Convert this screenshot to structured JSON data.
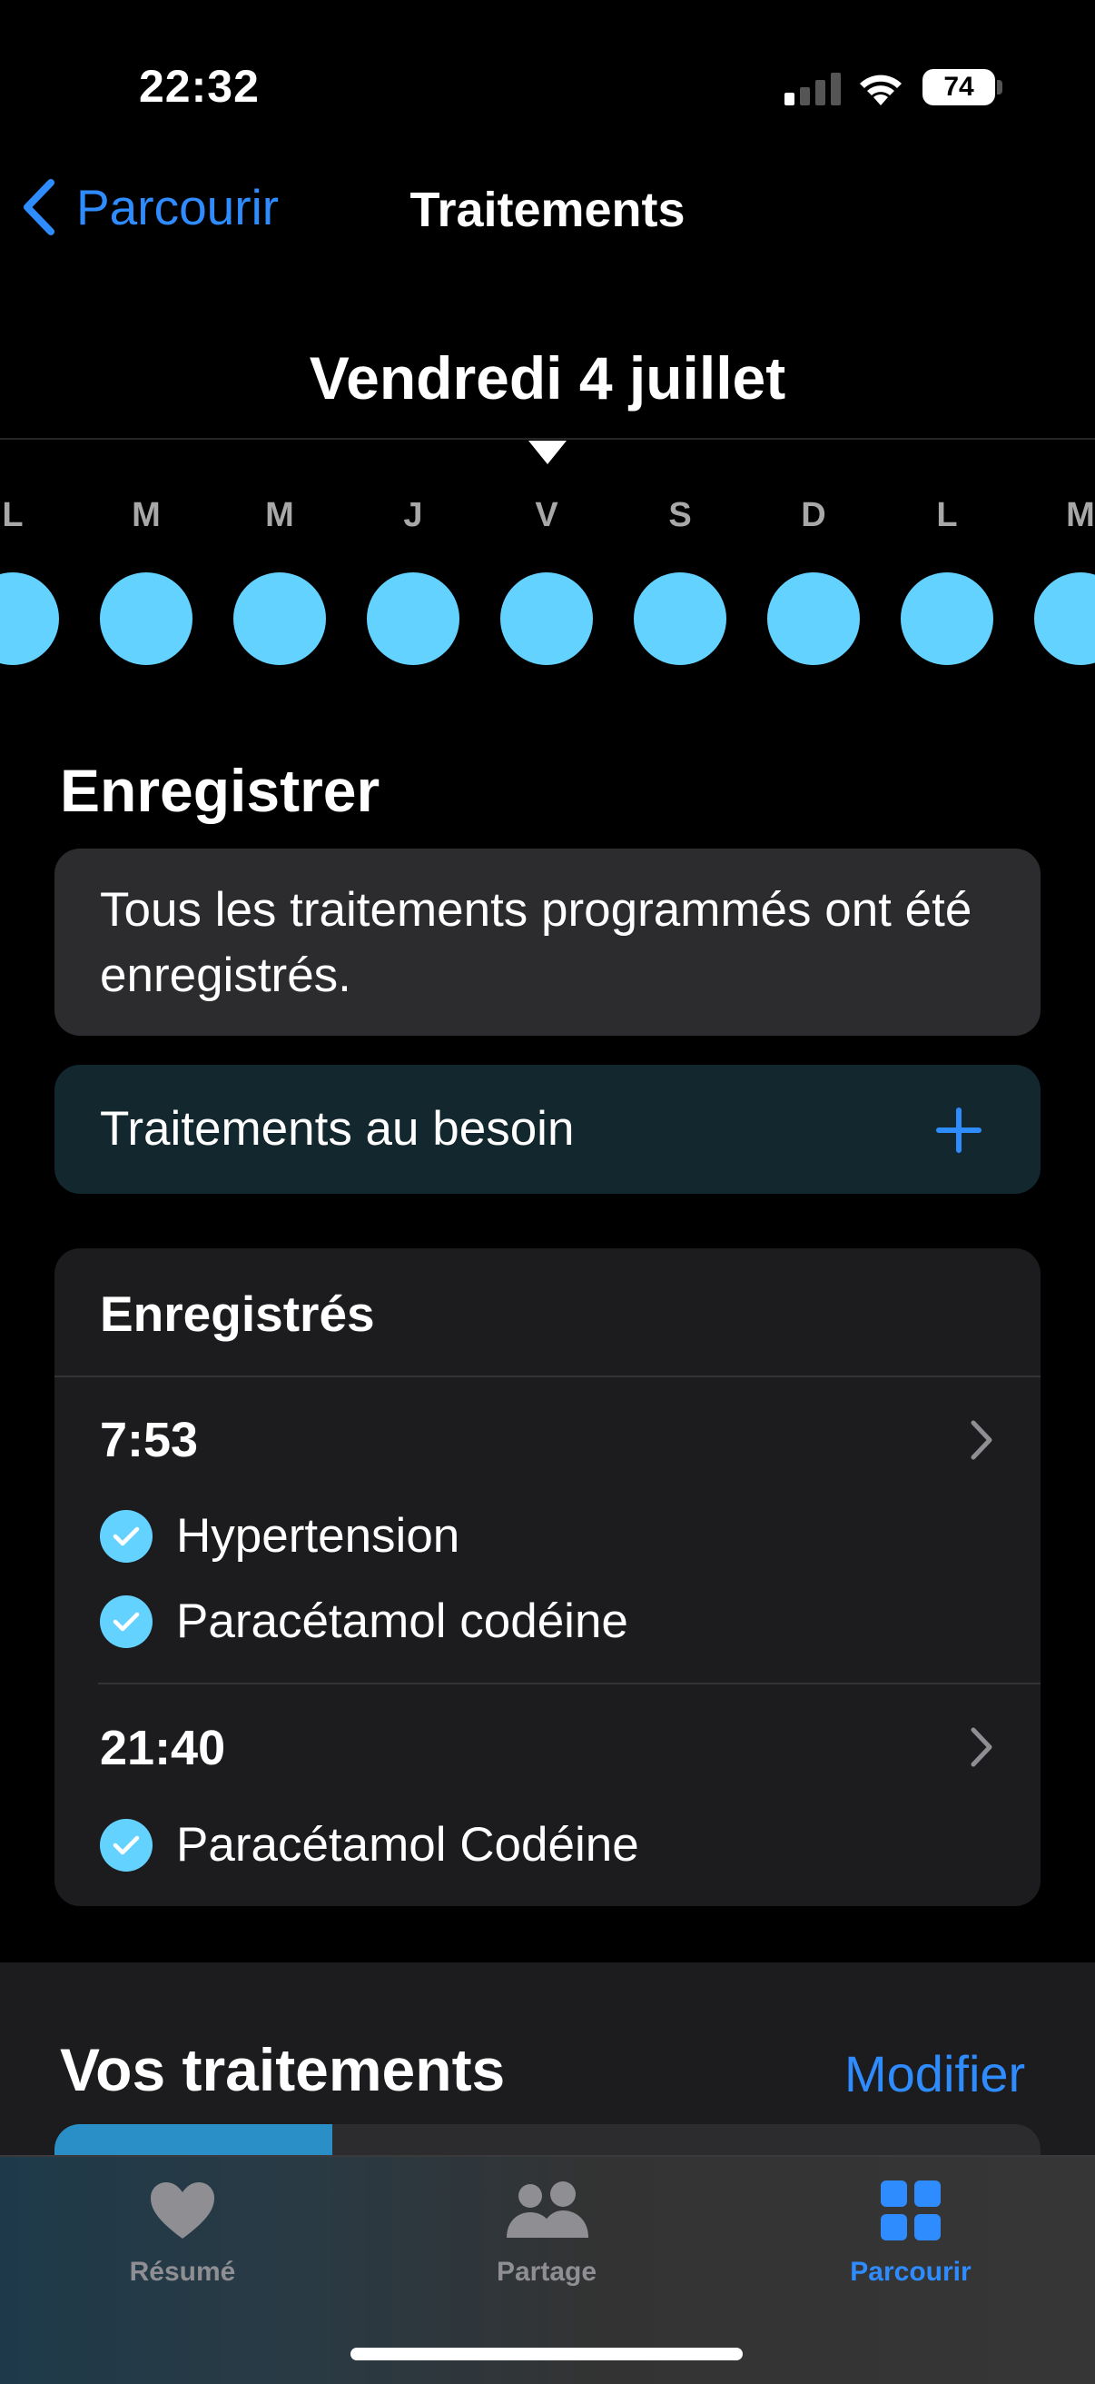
{
  "status_bar": {
    "time": "22:32",
    "battery": "74"
  },
  "nav": {
    "back_label": "Parcourir",
    "title": "Traitements"
  },
  "date_header": {
    "title": "Vendredi 4 juillet"
  },
  "week_strip": {
    "days": [
      "L",
      "M",
      "M",
      "J",
      "V",
      "S",
      "D",
      "L",
      "M"
    ],
    "dot_color": "#64d2ff"
  },
  "log_section": {
    "heading": "Enregistrer",
    "info_text": "Tous les traitements programmés ont été enregistrés.",
    "as_needed_label": "Traitements au besoin"
  },
  "logged": {
    "title": "Enregistrés",
    "entries": [
      {
        "time": "7:53",
        "meds": [
          "Hypertension",
          "Paracétamol codéine"
        ]
      },
      {
        "time": "21:40",
        "meds": [
          "Paracétamol Codéine"
        ]
      }
    ]
  },
  "your_meds": {
    "heading": "Vos traitements",
    "edit_label": "Modifier"
  },
  "tabbar": {
    "tabs": [
      {
        "label": "Résumé",
        "icon": "heart-icon"
      },
      {
        "label": "Partage",
        "icon": "people-icon"
      },
      {
        "label": "Parcourir",
        "icon": "grid-icon"
      }
    ],
    "active": "Parcourir"
  },
  "colors": {
    "accent": "#2f8cff",
    "dot": "#64d2ff"
  }
}
